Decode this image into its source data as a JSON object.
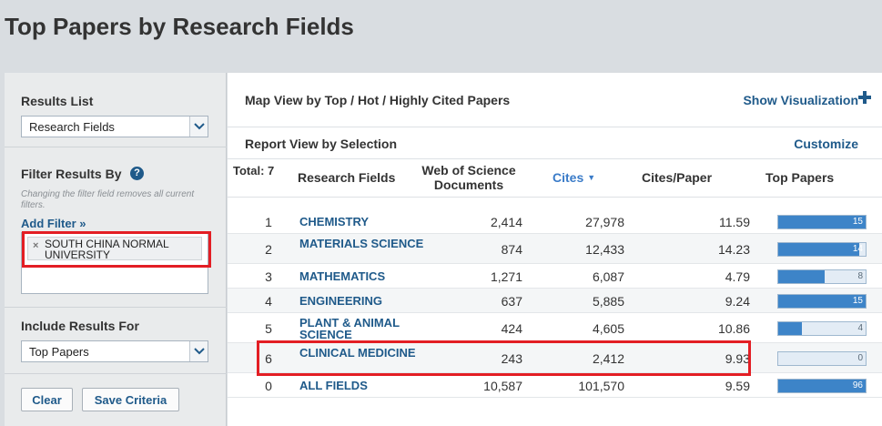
{
  "page": {
    "title": "Top Papers by Research Fields"
  },
  "sidebar": {
    "results_list_label": "Results List",
    "results_list_value": "Research Fields",
    "filter_by_label": "Filter Results By",
    "filter_note": "Changing the filter field removes all current filters.",
    "add_filter": "Add Filter »",
    "filter_chip": "SOUTH CHINA NORMAL UNIVERSITY",
    "include_label": "Include Results For",
    "include_value": "Top Papers",
    "clear_button": "Clear",
    "save_button": "Save Criteria",
    "help_glyph": "?"
  },
  "main": {
    "map_title": "Map View by Top / Hot / Highly Cited Papers",
    "show_viz": "Show Visualization",
    "report_title": "Report View by Selection",
    "customize": "Customize"
  },
  "table": {
    "total": "Total: 7",
    "headers": {
      "field": "Research Fields",
      "docs": "Web of Science Documents",
      "cites": "Cites",
      "cites_per_paper": "Cites/Paper",
      "top_papers": "Top Papers"
    },
    "rows": [
      {
        "rank": "1",
        "field": "CHEMISTRY",
        "docs": "2,414",
        "cites": "27,978",
        "cpp": "11.59",
        "top": "15",
        "top_fraction": 1.0
      },
      {
        "rank": "2",
        "field": "MATERIALS SCIENCE",
        "docs": "874",
        "cites": "12,433",
        "cpp": "14.23",
        "top": "14",
        "top_fraction": 0.93
      },
      {
        "rank": "3",
        "field": "MATHEMATICS",
        "docs": "1,271",
        "cites": "6,087",
        "cpp": "4.79",
        "top": "8",
        "top_fraction": 0.53
      },
      {
        "rank": "4",
        "field": "ENGINEERING",
        "docs": "637",
        "cites": "5,885",
        "cpp": "9.24",
        "top": "15",
        "top_fraction": 1.0
      },
      {
        "rank": "5",
        "field": "PLANT & ANIMAL SCIENCE",
        "docs": "424",
        "cites": "4,605",
        "cpp": "10.86",
        "top": "4",
        "top_fraction": 0.27
      },
      {
        "rank": "6",
        "field": "CLINICAL MEDICINE",
        "docs": "243",
        "cites": "2,412",
        "cpp": "9.93",
        "top": "0",
        "top_fraction": 0.0
      },
      {
        "rank": "0",
        "field": "ALL FIELDS",
        "docs": "10,587",
        "cites": "101,570",
        "cpp": "9.59",
        "top": "96",
        "top_fraction": 1.0
      }
    ]
  },
  "colors": {
    "accent": "#1f5a8a",
    "bar": "#3d84c8",
    "highlight": "#e31e24"
  }
}
